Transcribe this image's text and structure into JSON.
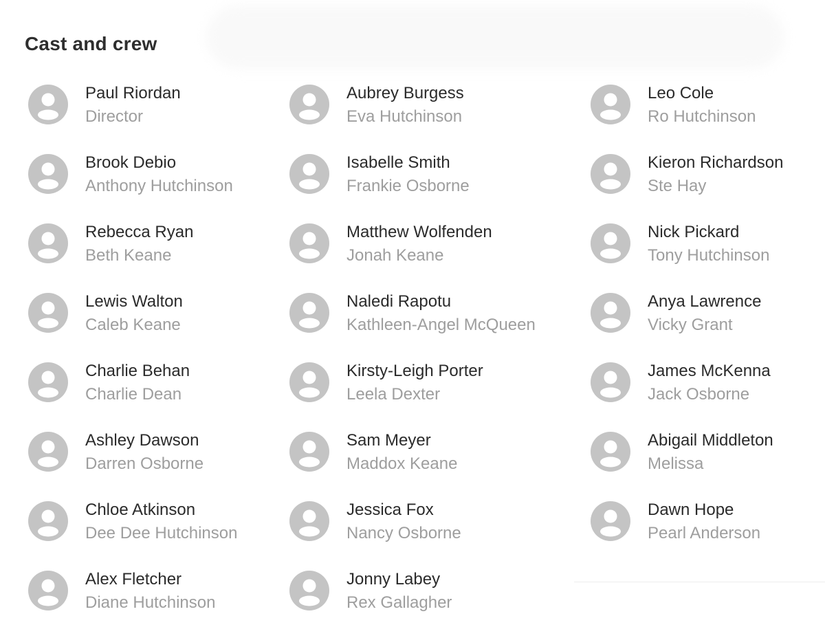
{
  "section": {
    "title": "Cast and crew"
  },
  "columns": [
    [
      {
        "name": "Paul Riordan",
        "role": "Director"
      },
      {
        "name": "Brook Debio",
        "role": "Anthony Hutchinson"
      },
      {
        "name": "Rebecca Ryan",
        "role": "Beth Keane"
      },
      {
        "name": "Lewis Walton",
        "role": "Caleb Keane"
      },
      {
        "name": "Charlie Behan",
        "role": "Charlie Dean"
      },
      {
        "name": "Ashley Dawson",
        "role": "Darren Osborne"
      },
      {
        "name": "Chloe Atkinson",
        "role": "Dee Dee Hutchinson"
      },
      {
        "name": "Alex Fletcher",
        "role": "Diane Hutchinson"
      }
    ],
    [
      {
        "name": "Aubrey Burgess",
        "role": "Eva Hutchinson"
      },
      {
        "name": "Isabelle Smith",
        "role": "Frankie Osborne"
      },
      {
        "name": "Matthew Wolfenden",
        "role": "Jonah Keane"
      },
      {
        "name": "Naledi Rapotu",
        "role": "Kathleen-Angel McQueen"
      },
      {
        "name": "Kirsty-Leigh Porter",
        "role": "Leela Dexter"
      },
      {
        "name": "Sam Meyer",
        "role": "Maddox Keane"
      },
      {
        "name": "Jessica Fox",
        "role": "Nancy Osborne"
      },
      {
        "name": "Jonny Labey",
        "role": "Rex Gallagher"
      }
    ],
    [
      {
        "name": "Leo Cole",
        "role": "Ro Hutchinson"
      },
      {
        "name": "Kieron Richardson",
        "role": "Ste Hay"
      },
      {
        "name": "Nick Pickard",
        "role": "Tony Hutchinson"
      },
      {
        "name": "Anya Lawrence",
        "role": "Vicky Grant"
      },
      {
        "name": "James McKenna",
        "role": "Jack Osborne"
      },
      {
        "name": "Abigail Middleton",
        "role": "Melissa"
      },
      {
        "name": "Dawn Hope",
        "role": "Pearl Anderson"
      }
    ]
  ],
  "colors": {
    "avatar": "#c4c4c4",
    "name": "#2b2b2b",
    "role": "#9e9e9e",
    "title": "#2e2e2e"
  },
  "icons": {
    "avatar": "person-placeholder-icon"
  }
}
